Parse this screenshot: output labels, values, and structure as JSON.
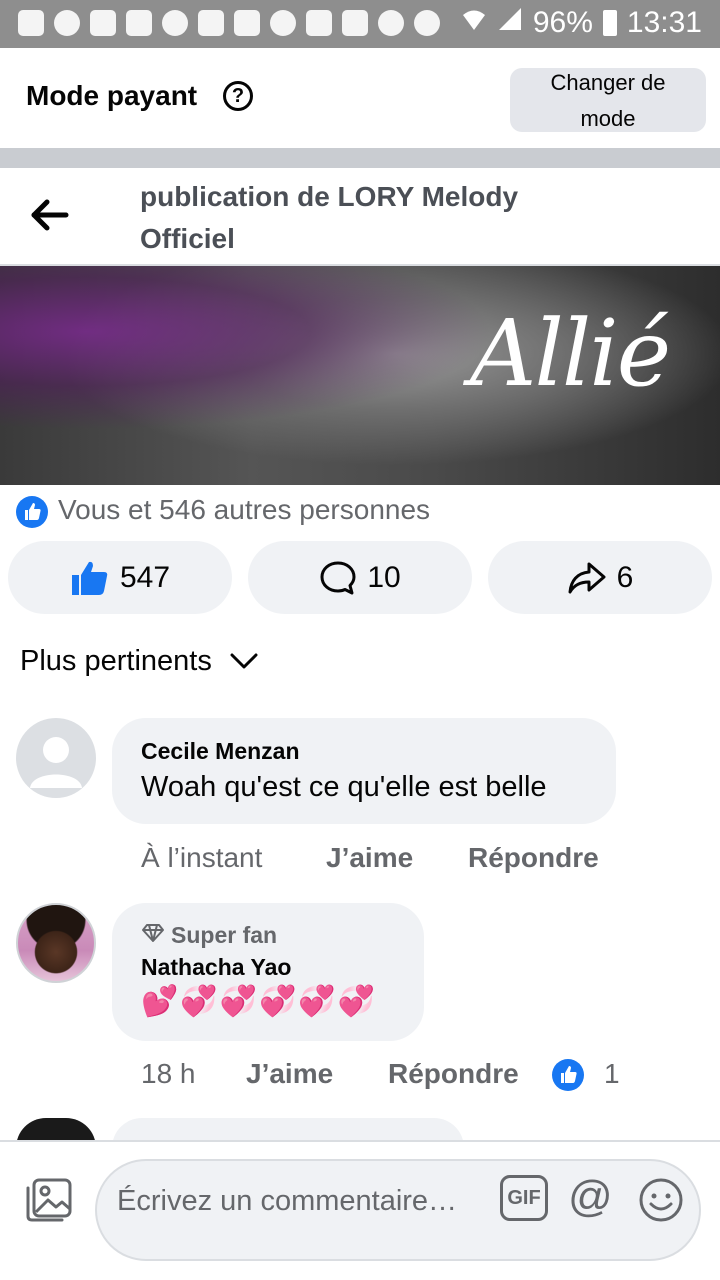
{
  "status_bar": {
    "battery": "96%",
    "time": "13:31"
  },
  "header": {
    "title": "Mode payant",
    "help_symbol": "?",
    "change_mode_line1": "Changer de",
    "change_mode_line2": "mode"
  },
  "post": {
    "title": "publication de LORY Melody Officiel",
    "image_text": "Allié",
    "reactions_summary": "Vous et 546 autres personnes",
    "like_count": "547",
    "comment_count": "10",
    "share_count": "6"
  },
  "sort": {
    "label": "Plus pertinents"
  },
  "comments": [
    {
      "name": "Cecile Menzan",
      "text": "Woah qu'est ce qu'elle est  belle",
      "time": "À l’instant",
      "like_label": "J’aime",
      "reply_label": "Répondre"
    },
    {
      "badge": "Super fan",
      "name": "Nathacha Yao",
      "text": "💕💞💞💞💞💞",
      "time": "18 h",
      "like_label": "J’aime",
      "reply_label": "Répondre",
      "reaction_count": "1"
    }
  ],
  "composer": {
    "placeholder": "Écrivez un commentaire…",
    "gif_label": "GIF",
    "at_symbol": "@"
  },
  "colors": {
    "accent": "#1877f2",
    "muted": "#65676b",
    "bubble": "#f0f2f5"
  }
}
